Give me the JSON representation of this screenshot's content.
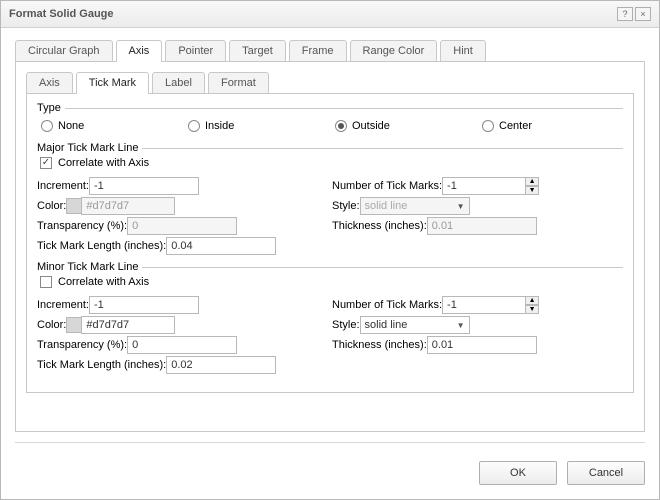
{
  "window": {
    "title": "Format Solid Gauge",
    "help_icon": "?",
    "close_icon": "×"
  },
  "mainTabs": [
    "Circular Graph",
    "Axis",
    "Pointer",
    "Target",
    "Frame",
    "Range Color",
    "Hint"
  ],
  "mainTabActive": 1,
  "subTabs": [
    "Axis",
    "Tick Mark",
    "Label",
    "Format"
  ],
  "subTabActive": 1,
  "type": {
    "legend": "Type",
    "options": [
      "None",
      "Inside",
      "Outside",
      "Center"
    ],
    "selected": 2
  },
  "major": {
    "legend": "Major Tick Mark Line",
    "correlateLabel": "Correlate with Axis",
    "correlateChecked": true,
    "labels": {
      "increment": "Increment:",
      "color": "Color:",
      "transparency": "Transparency (%):",
      "length": "Tick Mark Length (inches):",
      "numMarks": "Number of Tick Marks:",
      "style": "Style:",
      "thickness": "Thickness (inches):"
    },
    "values": {
      "increment": "-1",
      "color": "#d7d7d7",
      "transparency": "0",
      "length": "0.04",
      "numMarks": "-1",
      "style": "solid line",
      "thickness": "0.01"
    }
  },
  "minor": {
    "legend": "Minor Tick Mark Line",
    "correlateLabel": "Correlate with Axis",
    "correlateChecked": false,
    "labels": {
      "increment": "Increment:",
      "color": "Color:",
      "transparency": "Transparency (%):",
      "length": "Tick Mark Length (inches):",
      "numMarks": "Number of Tick Marks:",
      "style": "Style:",
      "thickness": "Thickness (inches):"
    },
    "values": {
      "increment": "-1",
      "color": "#d7d7d7",
      "transparency": "0",
      "length": "0.02",
      "numMarks": "-1",
      "style": "solid line",
      "thickness": "0.01"
    }
  },
  "buttons": {
    "ok": "OK",
    "cancel": "Cancel"
  }
}
